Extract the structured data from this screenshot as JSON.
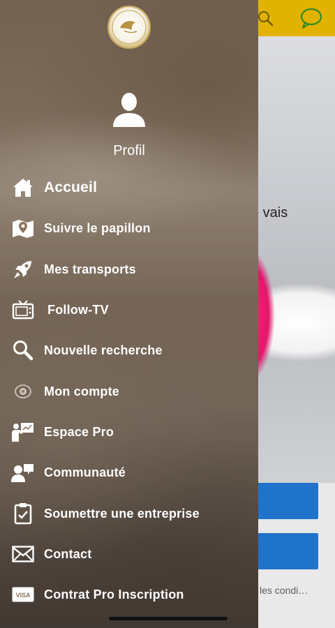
{
  "background": {
    "visible_fragment": "e vais",
    "terms_text": "les condi…",
    "topbar_color": "#e1b200",
    "button_color": "#1f73c9",
    "icons": [
      "search-icon",
      "chat-icon"
    ]
  },
  "drawer": {
    "logo": "logo-emblem",
    "profile": {
      "icon": "user-icon",
      "label": "Profil"
    },
    "items": [
      {
        "icon": "home-icon",
        "label": "Accueil"
      },
      {
        "icon": "map-pin-icon",
        "label": "Suivre le papillon"
      },
      {
        "icon": "rocket-icon",
        "label": "Mes transports"
      },
      {
        "icon": "tv-icon",
        "label": "Follow-TV"
      },
      {
        "icon": "search-icon",
        "label": "Nouvelle recherche"
      },
      {
        "icon": "eye-icon",
        "label": "Mon compte"
      },
      {
        "icon": "presentation-icon",
        "label": "Espace Pro"
      },
      {
        "icon": "community-icon",
        "label": "Communauté"
      },
      {
        "icon": "clipboard-icon",
        "label": "Soumettre une entreprise"
      },
      {
        "icon": "mail-icon",
        "label": "Contact"
      },
      {
        "icon": "visa-card-icon",
        "label": "Contrat Pro Inscription"
      }
    ]
  }
}
